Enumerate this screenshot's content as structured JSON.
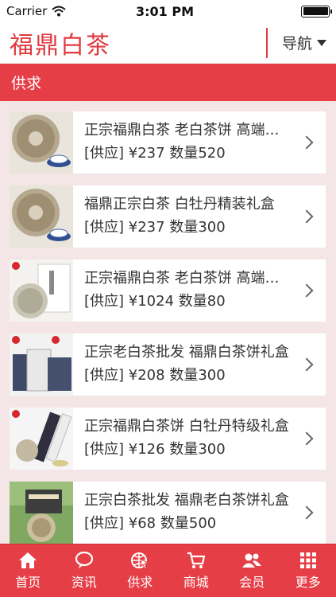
{
  "status": {
    "carrier": "Carrier",
    "time": "3:01 PM",
    "battery_level": 1.0
  },
  "header": {
    "title": "福鼎白茶",
    "nav_label": "导航"
  },
  "section": {
    "title": "供求"
  },
  "products": [
    {
      "title": "正宗福鼎白茶 老白茶饼 高端收藏",
      "type": "[供应]",
      "price": "¥237",
      "qty": "数量520",
      "image": "tea-cake"
    },
    {
      "title": "福鼎正宗白茶 白牡丹精装礼盒",
      "type": "[供应]",
      "price": "¥237",
      "qty": "数量300",
      "image": "tea-cake"
    },
    {
      "title": "正宗福鼎白茶 老白茶饼 高端礼品",
      "type": "[供应]",
      "price": "¥1024",
      "qty": "数量80",
      "image": "tea-box"
    },
    {
      "title": "正宗老白茶批发 福鼎白茶饼礼盒",
      "type": "[供应]",
      "price": "¥208",
      "qty": "数量300",
      "image": "tea-packs"
    },
    {
      "title": "正宗福鼎白茶饼 白牡丹特级礼盒",
      "type": "[供应]",
      "price": "¥126",
      "qty": "数量300",
      "image": "tea-gift"
    },
    {
      "title": "正宗白茶批发 福鼎老白茶饼礼盒",
      "type": "[供应]",
      "price": "¥68",
      "qty": "数量500",
      "image": "tea-field"
    }
  ],
  "tabs": [
    {
      "label": "首页",
      "icon": "home-icon"
    },
    {
      "label": "资讯",
      "icon": "chat-bubble-icon"
    },
    {
      "label": "供求",
      "icon": "globe-cursor-icon"
    },
    {
      "label": "商城",
      "icon": "cart-icon"
    },
    {
      "label": "会员",
      "icon": "members-icon"
    },
    {
      "label": "更多",
      "icon": "grid-icon"
    }
  ]
}
